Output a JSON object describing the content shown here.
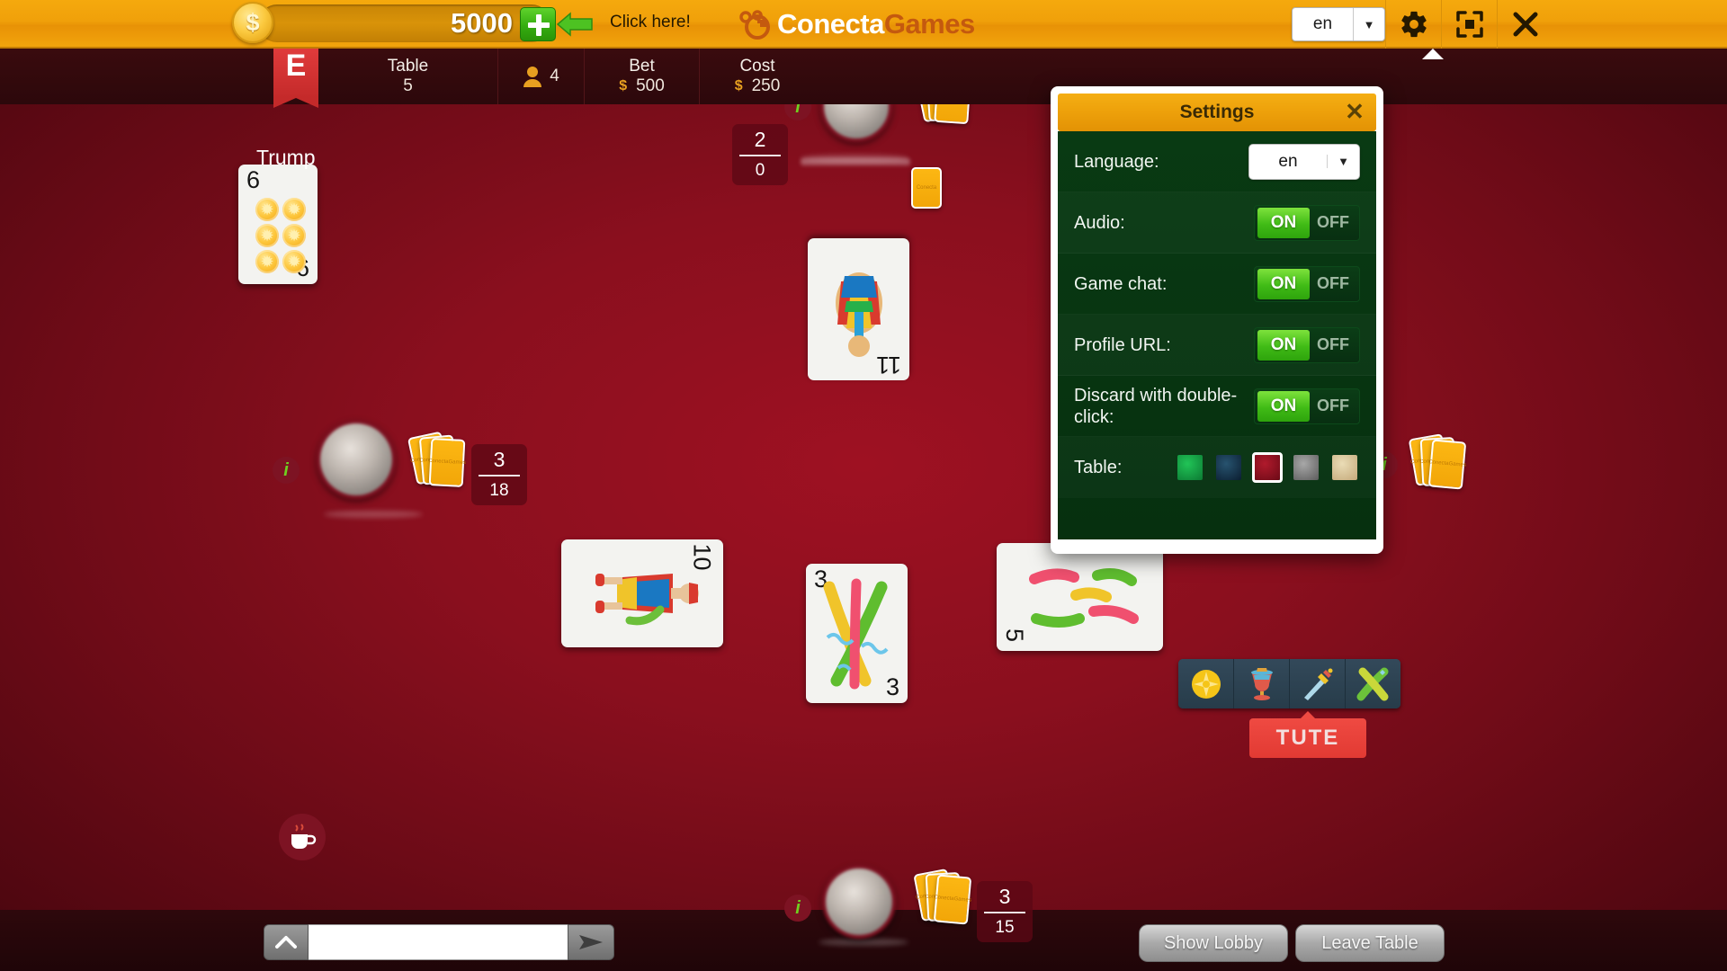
{
  "topbar": {
    "balance": "5000",
    "coin_symbol": "$",
    "plus_label": "+",
    "click_here": "Click here!",
    "logo_text_1": "Conecta",
    "logo_text_2": "Games",
    "language": "en",
    "caret": "▼",
    "close_glyph": "✕"
  },
  "infobar": {
    "rank_badge": "E",
    "table_label": "Table",
    "table_value": "5",
    "players_value": "4",
    "bet_label": "Bet",
    "bet_value": "500",
    "bet_currency": "$",
    "cost_label": "Cost",
    "cost_value": "250",
    "cost_currency": "$"
  },
  "table": {
    "trump_label": "Trump",
    "trump_card": {
      "rank": "6",
      "suit": "oros"
    },
    "played_cards": [
      {
        "rank": "11",
        "suit": "espadas",
        "rotated": true
      },
      {
        "rank": "10",
        "suit": "bastos",
        "rotated": true
      },
      {
        "rank": "3",
        "suit": "bastos",
        "rotated": false
      },
      {
        "rank": "5",
        "suit": "bastos",
        "rotated": true
      }
    ]
  },
  "players": {
    "top": {
      "score_top": "2",
      "score_bottom": "0"
    },
    "left": {
      "score_top": "3",
      "score_bottom": "18"
    },
    "bottom": {
      "score_top": "3",
      "score_bottom": "15"
    },
    "right": {
      "score_top": "",
      "score_bottom": ""
    }
  },
  "suitbar": {
    "suits": [
      {
        "name": "oros-suit-icon",
        "label": "Oros"
      },
      {
        "name": "copas-suit-icon",
        "label": "Copas"
      },
      {
        "name": "espadas-suit-icon",
        "label": "Espadas"
      },
      {
        "name": "bastos-suit-icon",
        "label": "Bastos"
      }
    ],
    "tute_label": "TUTE"
  },
  "bottombar": {
    "chat_placeholder": "",
    "chat_value": "",
    "show_lobby": "Show Lobby",
    "leave_table": "Leave Table"
  },
  "settings": {
    "title": "Settings",
    "close_glyph": "✕",
    "language_label": "Language:",
    "language_value": "en",
    "caret": "▼",
    "rows": [
      {
        "label": "Audio:",
        "on": "ON",
        "off": "OFF",
        "state": "on"
      },
      {
        "label": "Game chat:",
        "on": "ON",
        "off": "OFF",
        "state": "on"
      },
      {
        "label": "Profile URL:",
        "on": "ON",
        "off": "OFF",
        "state": "on"
      },
      {
        "label": "Discard with double-click:",
        "on": "ON",
        "off": "OFF",
        "state": "on"
      }
    ],
    "table_label": "Table:",
    "table_colors": [
      {
        "name": "green",
        "hex": "#119340",
        "selected": false
      },
      {
        "name": "blue",
        "hex": "#12314f",
        "selected": false
      },
      {
        "name": "red",
        "hex": "#9e1122",
        "selected": true
      },
      {
        "name": "gray",
        "hex": "#7d7d7d",
        "selected": false
      },
      {
        "name": "tan",
        "hex": "#d8c193",
        "selected": false
      }
    ]
  },
  "colors": {
    "accent_orange": "#f0a00a",
    "felt_red": "#9e1122",
    "toggle_green": "#40bb16",
    "dialog_green": "#093a13"
  }
}
